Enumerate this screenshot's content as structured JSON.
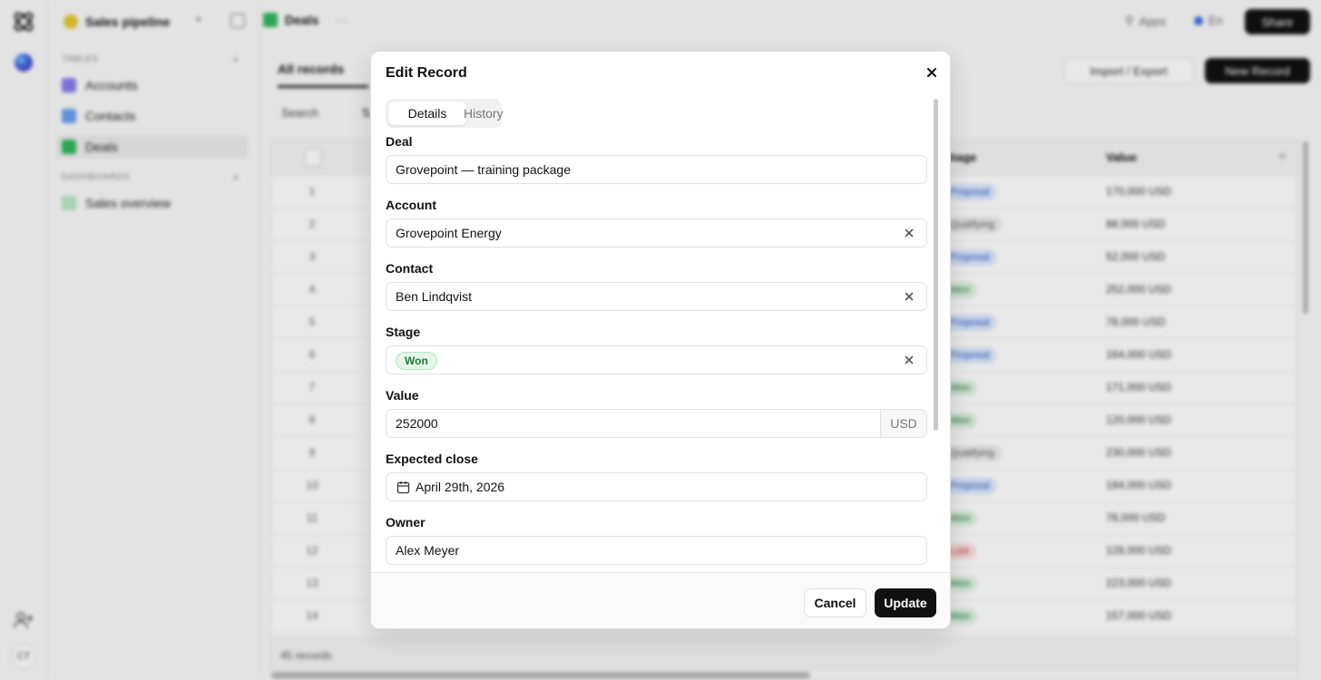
{
  "rail": {
    "avatar_initials": "CT"
  },
  "sidebar": {
    "workspace": "Sales pipeline",
    "tables_title": "TABLES",
    "dashboards_title": "DASHBOARDS",
    "items": [
      {
        "label": "Accounts",
        "color": "#8a7be6"
      },
      {
        "label": "Contacts",
        "color": "#6aa0f0"
      },
      {
        "label": "Deals",
        "color": "#2fb85a"
      }
    ],
    "dashboard_items": [
      {
        "label": "Sales overview",
        "color": "#2fb85a"
      }
    ]
  },
  "topbar": {
    "breadcrumb": "Deals",
    "apps_label": "Apps",
    "presence_label": "En",
    "share_label": "Share"
  },
  "toolbar": {
    "records_tab": "All records",
    "search_label": "Search",
    "import_label": "Import / Export",
    "new_label": "New Record"
  },
  "table": {
    "stage_header": "Stage",
    "value_header": "Value",
    "rows": [
      {
        "n": "1",
        "stage": "Proposal",
        "value": "170,000 USD"
      },
      {
        "n": "2",
        "stage": "Qualifying",
        "value": "88,000 USD"
      },
      {
        "n": "3",
        "stage": "Proposal",
        "value": "52,000 USD"
      },
      {
        "n": "4",
        "stage": "Won",
        "value": "252,000 USD"
      },
      {
        "n": "5",
        "stage": "Proposal",
        "value": "78,000 USD"
      },
      {
        "n": "6",
        "stage": "Proposal",
        "value": "164,000 USD"
      },
      {
        "n": "7",
        "stage": "Won",
        "value": "171,000 USD"
      },
      {
        "n": "8",
        "stage": "Won",
        "value": "120,000 USD"
      },
      {
        "n": "9",
        "stage": "Qualifying",
        "value": "230,000 USD"
      },
      {
        "n": "10",
        "stage": "Proposal",
        "value": "184,000 USD"
      },
      {
        "n": "11",
        "stage": "Won",
        "value": "78,000 USD"
      },
      {
        "n": "12",
        "stage": "Lost",
        "value": "128,000 USD"
      },
      {
        "n": "13",
        "stage": "Won",
        "value": "223,000 USD"
      },
      {
        "n": "14",
        "stage": "Won",
        "value": "157,000 USD"
      }
    ],
    "footer": "45 records"
  },
  "modal": {
    "title": "Edit Record",
    "tabs": {
      "details": "Details",
      "history": "History"
    },
    "fields": {
      "deal": {
        "label": "Deal",
        "value": "Grovepoint — training package"
      },
      "account": {
        "label": "Account",
        "value": "Grovepoint Energy"
      },
      "contact": {
        "label": "Contact",
        "value": "Ben Lindqvist"
      },
      "stage": {
        "label": "Stage",
        "value": "Won"
      },
      "value": {
        "label": "Value",
        "value": "252000",
        "unit": "USD"
      },
      "expected_close": {
        "label": "Expected close",
        "value": "April 29th, 2026"
      },
      "owner": {
        "label": "Owner",
        "value": "Alex Meyer"
      }
    },
    "cancel_label": "Cancel",
    "update_label": "Update"
  },
  "colors": {
    "won_bg": "#e4f6e8",
    "won_text": "#1e7a39",
    "primary_button": "#111111"
  }
}
